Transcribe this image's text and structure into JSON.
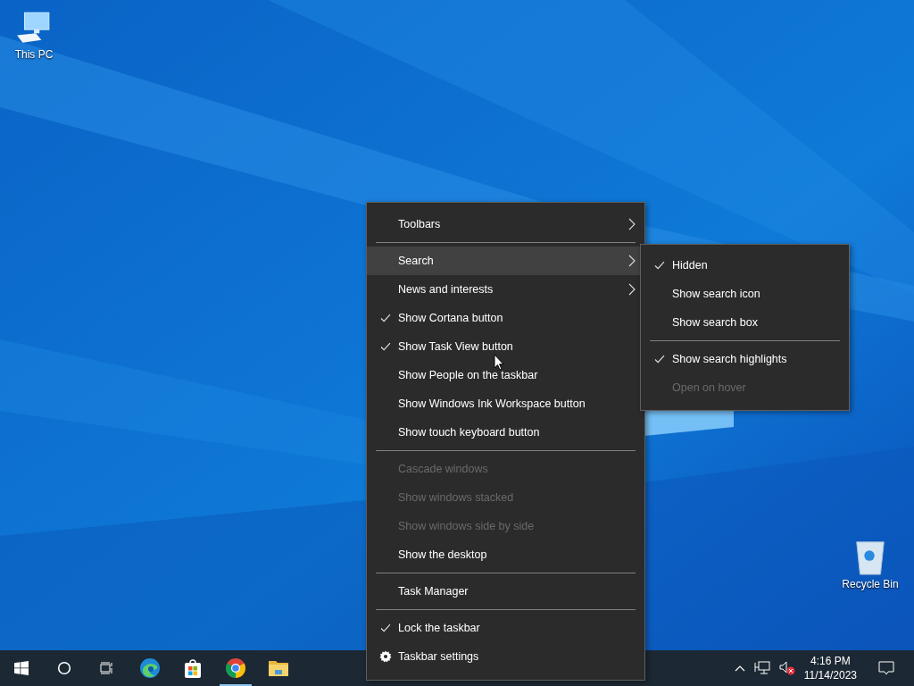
{
  "desktop_icons": [
    {
      "kind": "computer",
      "label": "This PC"
    },
    {
      "kind": "recycle-bin",
      "label": "Recycle Bin"
    }
  ],
  "context_menu": {
    "items": [
      {
        "kind": "item",
        "label": "Toolbars",
        "checked": false,
        "disabled": false,
        "submenu": true,
        "selected": false
      },
      {
        "kind": "separator"
      },
      {
        "kind": "item",
        "label": "Search",
        "checked": false,
        "disabled": false,
        "submenu": true,
        "selected": true
      },
      {
        "kind": "item",
        "label": "News and interests",
        "checked": false,
        "disabled": false,
        "submenu": true,
        "selected": false
      },
      {
        "kind": "item",
        "label": "Show Cortana button",
        "checked": true,
        "disabled": false,
        "submenu": false,
        "selected": false
      },
      {
        "kind": "item",
        "label": "Show Task View button",
        "checked": true,
        "disabled": false,
        "submenu": false,
        "selected": false
      },
      {
        "kind": "item",
        "label": "Show People on the taskbar",
        "checked": false,
        "disabled": false,
        "submenu": false,
        "selected": false
      },
      {
        "kind": "item",
        "label": "Show Windows Ink Workspace button",
        "checked": false,
        "disabled": false,
        "submenu": false,
        "selected": false
      },
      {
        "kind": "item",
        "label": "Show touch keyboard button",
        "checked": false,
        "disabled": false,
        "submenu": false,
        "selected": false
      },
      {
        "kind": "separator"
      },
      {
        "kind": "item",
        "label": "Cascade windows",
        "checked": false,
        "disabled": true,
        "submenu": false,
        "selected": false
      },
      {
        "kind": "item",
        "label": "Show windows stacked",
        "checked": false,
        "disabled": true,
        "submenu": false,
        "selected": false
      },
      {
        "kind": "item",
        "label": "Show windows side by side",
        "checked": false,
        "disabled": true,
        "submenu": false,
        "selected": false
      },
      {
        "kind": "item",
        "label": "Show the desktop",
        "checked": false,
        "disabled": false,
        "submenu": false,
        "selected": false
      },
      {
        "kind": "separator"
      },
      {
        "kind": "item",
        "label": "Task Manager",
        "checked": false,
        "disabled": false,
        "submenu": false,
        "selected": false
      },
      {
        "kind": "separator"
      },
      {
        "kind": "item",
        "label": "Lock the taskbar",
        "checked": true,
        "disabled": false,
        "submenu": false,
        "selected": false
      },
      {
        "kind": "settings",
        "label": "Taskbar settings",
        "disabled": false,
        "submenu": false,
        "selected": false
      }
    ]
  },
  "search_submenu": {
    "items": [
      {
        "kind": "item",
        "label": "Hidden",
        "checked": true,
        "disabled": false
      },
      {
        "kind": "item",
        "label": "Show search icon",
        "checked": false,
        "disabled": false
      },
      {
        "kind": "item",
        "label": "Show search box",
        "checked": false,
        "disabled": false
      },
      {
        "kind": "separator"
      },
      {
        "kind": "item",
        "label": "Show search highlights",
        "checked": true,
        "disabled": false
      },
      {
        "kind": "item",
        "label": "Open on hover",
        "checked": false,
        "disabled": true
      }
    ]
  },
  "taskbar": {
    "buttons": [
      {
        "kind": "start",
        "running": false
      },
      {
        "kind": "cortana",
        "running": false
      },
      {
        "kind": "task-view",
        "running": false
      },
      {
        "kind": "edge",
        "running": false
      },
      {
        "kind": "store",
        "running": false
      },
      {
        "kind": "chrome",
        "running": true
      },
      {
        "kind": "explorer",
        "running": false
      }
    ],
    "tray": {
      "volume_muted": true,
      "time": "4:16 PM",
      "date": "11/14/2023"
    }
  }
}
